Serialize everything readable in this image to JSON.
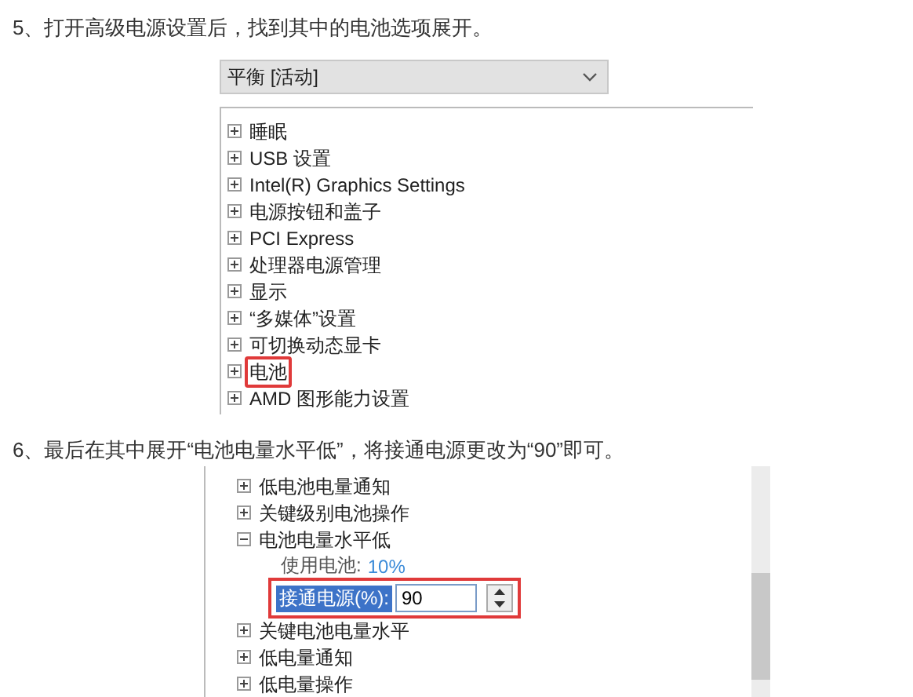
{
  "steps": [
    {
      "text": "5、打开高级电源设置后，找到其中的电池选项展开。",
      "dropdown": {
        "value": "平衡 [活动]"
      },
      "tree": [
        {
          "kind": "node",
          "label": "睡眠",
          "expanded": false,
          "highlighted": false
        },
        {
          "kind": "node",
          "label": "USB 设置",
          "expanded": false,
          "highlighted": false
        },
        {
          "kind": "node",
          "label": "Intel(R) Graphics Settings",
          "expanded": false,
          "highlighted": false
        },
        {
          "kind": "node",
          "label": "电源按钮和盖子",
          "expanded": false,
          "highlighted": false
        },
        {
          "kind": "node",
          "label": "PCI Express",
          "expanded": false,
          "highlighted": false
        },
        {
          "kind": "node",
          "label": "处理器电源管理",
          "expanded": false,
          "highlighted": false
        },
        {
          "kind": "node",
          "label": "显示",
          "expanded": false,
          "highlighted": false
        },
        {
          "kind": "node",
          "label": "“多媒体”设置",
          "expanded": false,
          "highlighted": false
        },
        {
          "kind": "node",
          "label": "可切换动态显卡",
          "expanded": false,
          "highlighted": false
        },
        {
          "kind": "node",
          "label": "电池",
          "expanded": false,
          "highlighted": true
        },
        {
          "kind": "node",
          "label": "AMD 图形能力设置",
          "expanded": false,
          "highlighted": false
        }
      ]
    },
    {
      "text": "6、最后在其中展开“电池电量水平低”，将接通电源更改为“90”即可。",
      "tree": [
        {
          "kind": "node",
          "label": "低电池电量通知",
          "expanded": false,
          "highlighted": false
        },
        {
          "kind": "node",
          "label": "关键级别电池操作",
          "expanded": false,
          "highlighted": false
        },
        {
          "kind": "node",
          "label": "电池电量水平低",
          "expanded": true,
          "highlighted": false,
          "children": [
            {
              "kind": "value",
              "label": "使用电池:",
              "value": "10%"
            },
            {
              "kind": "spin",
              "label": "接通电源(%):",
              "value": "90",
              "highlighted": true
            }
          ]
        },
        {
          "kind": "node",
          "label": "关键电池电量水平",
          "expanded": false,
          "highlighted": false
        },
        {
          "kind": "node",
          "label": "低电量通知",
          "expanded": false,
          "highlighted": false
        },
        {
          "kind": "node",
          "label": "低电量操作",
          "expanded": false,
          "highlighted": false
        }
      ]
    }
  ]
}
